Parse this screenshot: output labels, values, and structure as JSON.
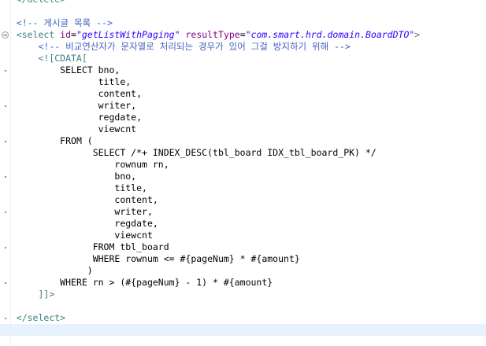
{
  "editor": {
    "lines": [
      {
        "indent": "",
        "parts": [
          {
            "t": "</delete>",
            "c": "t-tag"
          }
        ]
      },
      {
        "indent": "",
        "parts": []
      },
      {
        "indent": "",
        "parts": [
          {
            "t": "<!-- 게시글 목록 -->",
            "c": "t-comment"
          }
        ]
      },
      {
        "indent": "",
        "parts": [
          {
            "t": "<select ",
            "c": "t-tag"
          },
          {
            "t": "id",
            "c": "t-attr"
          },
          {
            "t": "=",
            "c": "t-text"
          },
          {
            "t": "\"getListWithPaging\"",
            "c": "t-val"
          },
          {
            "t": " ",
            "c": "t-text"
          },
          {
            "t": "resultType",
            "c": "t-attr"
          },
          {
            "t": "=",
            "c": "t-text"
          },
          {
            "t": "\"com.smart.hrd.domain.BoardDTO\"",
            "c": "t-val"
          },
          {
            "t": ">",
            "c": "t-tag"
          }
        ]
      },
      {
        "indent": "    ",
        "parts": [
          {
            "t": "<!-- 비교연산자가 문자열로 처리되는 경우가 있어 그걸 방지하기 위해 -->",
            "c": "t-comment"
          }
        ]
      },
      {
        "indent": "    ",
        "parts": [
          {
            "t": "<![CDATA[",
            "c": "t-cdata"
          }
        ]
      },
      {
        "indent": "        ",
        "parts": [
          {
            "t": "SELECT bno,",
            "c": "t-text"
          }
        ]
      },
      {
        "indent": "               ",
        "parts": [
          {
            "t": "title,",
            "c": "t-text"
          }
        ]
      },
      {
        "indent": "               ",
        "parts": [
          {
            "t": "content,",
            "c": "t-text"
          }
        ]
      },
      {
        "indent": "               ",
        "parts": [
          {
            "t": "writer,",
            "c": "t-text"
          }
        ]
      },
      {
        "indent": "               ",
        "parts": [
          {
            "t": "regdate,",
            "c": "t-text"
          }
        ]
      },
      {
        "indent": "               ",
        "parts": [
          {
            "t": "viewcnt",
            "c": "t-text"
          }
        ]
      },
      {
        "indent": "        ",
        "parts": [
          {
            "t": "FROM (",
            "c": "t-text"
          }
        ]
      },
      {
        "indent": "              ",
        "parts": [
          {
            "t": "SELECT /*+ INDEX_DESC(tbl_board IDX_tbl_board_PK) */",
            "c": "t-text"
          }
        ]
      },
      {
        "indent": "                  ",
        "parts": [
          {
            "t": "rownum rn,",
            "c": "t-text"
          }
        ]
      },
      {
        "indent": "                  ",
        "parts": [
          {
            "t": "bno,",
            "c": "t-text"
          }
        ]
      },
      {
        "indent": "                  ",
        "parts": [
          {
            "t": "title,",
            "c": "t-text"
          }
        ]
      },
      {
        "indent": "                  ",
        "parts": [
          {
            "t": "content,",
            "c": "t-text"
          }
        ]
      },
      {
        "indent": "                  ",
        "parts": [
          {
            "t": "writer,",
            "c": "t-text"
          }
        ]
      },
      {
        "indent": "                  ",
        "parts": [
          {
            "t": "regdate,",
            "c": "t-text"
          }
        ]
      },
      {
        "indent": "                  ",
        "parts": [
          {
            "t": "viewcnt",
            "c": "t-text"
          }
        ]
      },
      {
        "indent": "              ",
        "parts": [
          {
            "t": "FROM tbl_board",
            "c": "t-text"
          }
        ]
      },
      {
        "indent": "              ",
        "parts": [
          {
            "t": "WHERE rownum <= #{pageNum} * #{amount}",
            "c": "t-text"
          }
        ]
      },
      {
        "indent": "             ",
        "parts": [
          {
            "t": ")",
            "c": "t-text"
          }
        ]
      },
      {
        "indent": "        ",
        "parts": [
          {
            "t": "WHERE rn > (#{pageNum} - 1) * #{amount}",
            "c": "t-text"
          }
        ]
      },
      {
        "indent": "    ",
        "parts": [
          {
            "t": "]]>",
            "c": "t-cdata"
          }
        ]
      },
      {
        "indent": "",
        "parts": []
      },
      {
        "indent": "",
        "parts": [
          {
            "t": "</select>",
            "c": "t-tag"
          }
        ]
      },
      {
        "indent": "",
        "parts": []
      }
    ]
  }
}
